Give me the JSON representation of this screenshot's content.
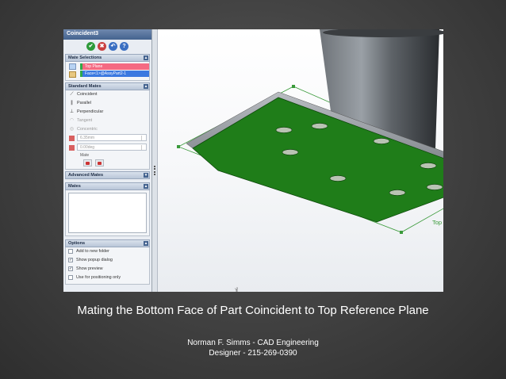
{
  "property_manager": {
    "title": "Coincident3",
    "action_buttons": [
      "✔",
      "✖",
      "↶",
      "?"
    ],
    "mate_selections": {
      "header": "Mate Selections",
      "items": [
        "Top Plane",
        "Face<1>@AssyPart2-1"
      ]
    },
    "standard_mates": {
      "header": "Standard Mates",
      "items": [
        "Coincident",
        "Parallel",
        "Perpendicular",
        "Tangent",
        "Concentric"
      ],
      "distance_value": "6.35mm",
      "angle_value": "0.00deg",
      "alignment_label": "Mate"
    },
    "advanced_mates": {
      "header": "Advanced Mates"
    },
    "mates": {
      "header": "Mates"
    },
    "options": {
      "header": "Options",
      "items": [
        {
          "label": "Add to new folder",
          "checked": false
        },
        {
          "label": "Show popup dialog",
          "checked": true
        },
        {
          "label": "Show preview",
          "checked": true
        },
        {
          "label": "Use for positioning only",
          "checked": false
        }
      ]
    }
  },
  "graphics": {
    "plane_label": "Top Plane",
    "axis_label": "Y"
  },
  "caption": "Mating the Bottom Face of Part Coincident to Top Reference Plane",
  "credit": {
    "line1": "Norman F. Simms - CAD Engineering",
    "line2": "Designer - 215-269-0390"
  },
  "colors": {
    "part_face": "#1f7d19",
    "plane_outline": "#3a9a3a",
    "selection_pink": "#f46a82",
    "selection_blue": "#3a78e0",
    "panel_title": "#44638f"
  }
}
